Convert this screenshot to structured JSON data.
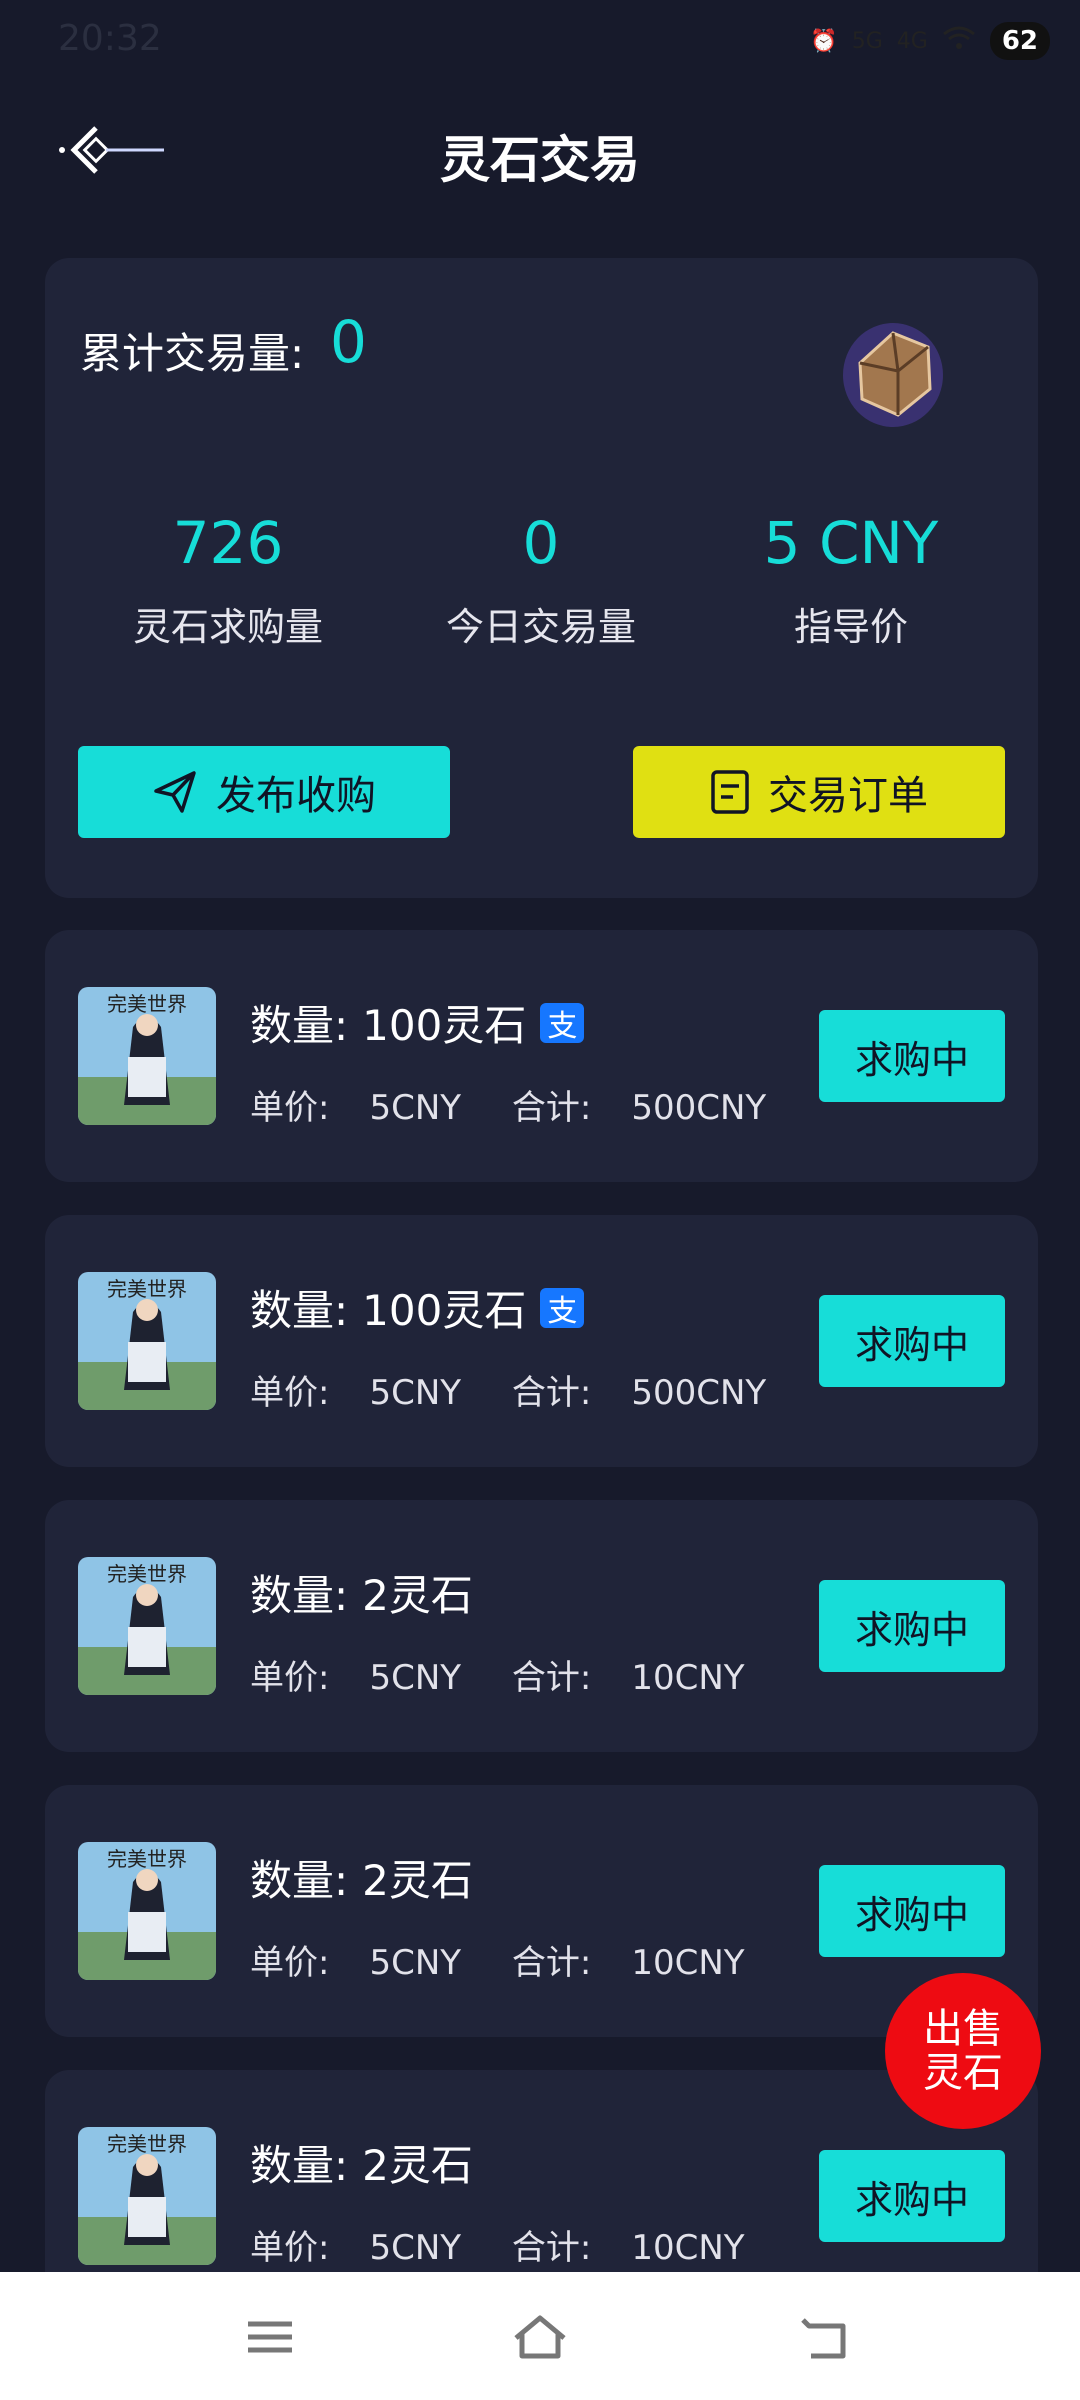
{
  "status_bar": {
    "time": "20:32",
    "battery": "62",
    "net1": "5G",
    "net2": "4G"
  },
  "header": {
    "title": "灵石交易"
  },
  "summary": {
    "total_label": "累计交易量:",
    "total_value": "0",
    "stats": [
      {
        "value": "726",
        "label": "灵石求购量"
      },
      {
        "value": "0",
        "label": "今日交易量"
      },
      {
        "value": "5 CNY",
        "label": "指导价"
      }
    ],
    "publish_label": "发布收购",
    "orders_label": "交易订单"
  },
  "listings": [
    {
      "qty_label": "数量:",
      "qty": "100灵石",
      "pay": "支",
      "unit_label": "单价:",
      "unit": "5CNY",
      "sum_label": "合计:",
      "sum": "500CNY",
      "status": "求购中"
    },
    {
      "qty_label": "数量:",
      "qty": "100灵石",
      "pay": "支",
      "unit_label": "单价:",
      "unit": "5CNY",
      "sum_label": "合计:",
      "sum": "500CNY",
      "status": "求购中"
    },
    {
      "qty_label": "数量:",
      "qty": "2灵石",
      "pay": "",
      "unit_label": "单价:",
      "unit": "5CNY",
      "sum_label": "合计:",
      "sum": "10CNY",
      "status": "求购中"
    },
    {
      "qty_label": "数量:",
      "qty": "2灵石",
      "pay": "",
      "unit_label": "单价:",
      "unit": "5CNY",
      "sum_label": "合计:",
      "sum": "10CNY",
      "status": "求购中"
    },
    {
      "qty_label": "数量:",
      "qty": "2灵石",
      "pay": "",
      "unit_label": "单价:",
      "unit": "5CNY",
      "sum_label": "合计:",
      "sum": "10CNY",
      "status": "求购中"
    }
  ],
  "fab": {
    "line1": "出售",
    "line2": "灵石"
  },
  "colors": {
    "accent": "#17ddd8",
    "yellow": "#e0e012",
    "bg": "#171a2b",
    "card": "#202439",
    "fab": "#ee0b12"
  }
}
